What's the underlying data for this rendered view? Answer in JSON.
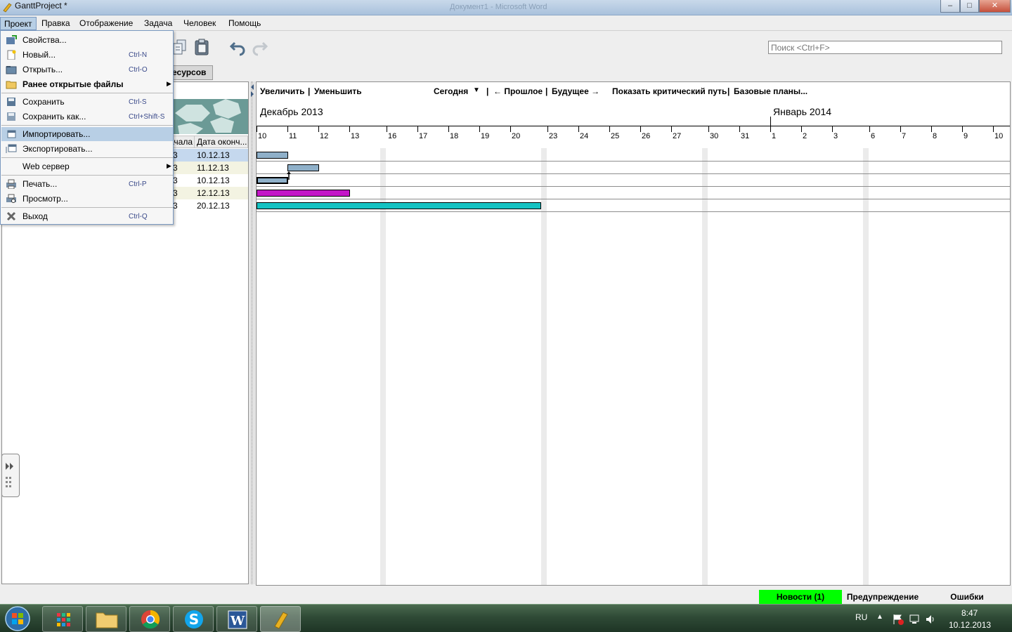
{
  "window": {
    "title": "GanttProject *",
    "background_window_title": "Документ1 - Microsoft Word"
  },
  "menubar": {
    "items": [
      "Проект",
      "Правка",
      "Отображение",
      "Задача",
      "Человек",
      "Помощь"
    ],
    "active": "Проект"
  },
  "dropdown": {
    "items": [
      {
        "label": "Свойства...",
        "shortcut": "",
        "icon": "properties-icon"
      },
      {
        "label": "Новый...",
        "shortcut": "Ctrl-N",
        "icon": "new-file-icon"
      },
      {
        "label": "Открыть...",
        "shortcut": "Ctrl-O",
        "icon": "open-folder-icon"
      },
      {
        "label": "Ранее открытые файлы",
        "shortcut": "",
        "icon": "folder-icon",
        "submenu": true
      },
      {
        "label": "Сохранить",
        "shortcut": "Ctrl-S",
        "icon": "save-icon"
      },
      {
        "label": "Сохранить как...",
        "shortcut": "Ctrl+Shift-S",
        "icon": "save-as-icon"
      },
      {
        "label": "Импортировать...",
        "shortcut": "",
        "icon": "import-icon",
        "highlighted": true
      },
      {
        "label": "Экспортировать...",
        "shortcut": "",
        "icon": "export-icon"
      },
      {
        "label": "Web сервер",
        "shortcut": "",
        "icon": "",
        "submenu": true
      },
      {
        "label": "Печать...",
        "shortcut": "Ctrl-P",
        "icon": "print-icon"
      },
      {
        "label": "Просмотр...",
        "shortcut": "",
        "icon": "print-preview-icon"
      },
      {
        "label": "Выход",
        "shortcut": "Ctrl-Q",
        "icon": "exit-icon"
      }
    ]
  },
  "toolbar": {
    "search_placeholder": "Поиск <Ctrl+F>"
  },
  "tabs": {
    "resources_partial": "есурсов"
  },
  "task_table": {
    "headers": [
      "ачала",
      "Дата оконч..."
    ],
    "rows": [
      {
        "start_tail": "3",
        "end": "10.12.13"
      },
      {
        "start_tail": "3",
        "end": "11.12.13"
      },
      {
        "start_tail": "3",
        "end": "10.12.13"
      },
      {
        "start_tail": "3",
        "end": "12.12.13"
      },
      {
        "start_tail": "3",
        "end": "20.12.13"
      }
    ]
  },
  "chart_nav": {
    "zoom_in": "Увеличить",
    "sep1": "|",
    "zoom_out": "Уменьшить",
    "today": "Сегодня",
    "sep2": "|",
    "past": "← Прошлое",
    "sep3": "|",
    "future": "Будущее →",
    "critical_path": "Показать критический путь",
    "sep4": "|",
    "baselines": "Базовые планы..."
  },
  "timeline": {
    "months": [
      "Декабрь 2013",
      "Январь 2014"
    ],
    "days": [
      "10",
      "11",
      "12",
      "13",
      "16",
      "17",
      "18",
      "19",
      "20",
      "23",
      "24",
      "25",
      "26",
      "27",
      "30",
      "31",
      "1",
      "2",
      "3",
      "6",
      "7",
      "8",
      "9",
      "10"
    ]
  },
  "tasks": [
    {
      "start": "10.12.13",
      "end": "10.12.13",
      "color": "#8fb0c9"
    },
    {
      "start": "11.12.13",
      "end": "11.12.13",
      "color": "#8fb0c9"
    },
    {
      "start": "10.12.13",
      "end": "10.12.13",
      "color": "#8fb0c9"
    },
    {
      "start": "10.12.13",
      "end": "12.12.13",
      "color": "#c416c8"
    },
    {
      "start": "10.12.13",
      "end": "20.12.13",
      "color": "#14c2c2"
    }
  ],
  "statusbar": {
    "news": "Новости (1)",
    "warning": "Предупреждение",
    "errors": "Ошибки",
    "news_color": "#00ff00"
  },
  "taskbar": {
    "lang": "RU",
    "time": "8:47",
    "date": "10.12.2013"
  }
}
